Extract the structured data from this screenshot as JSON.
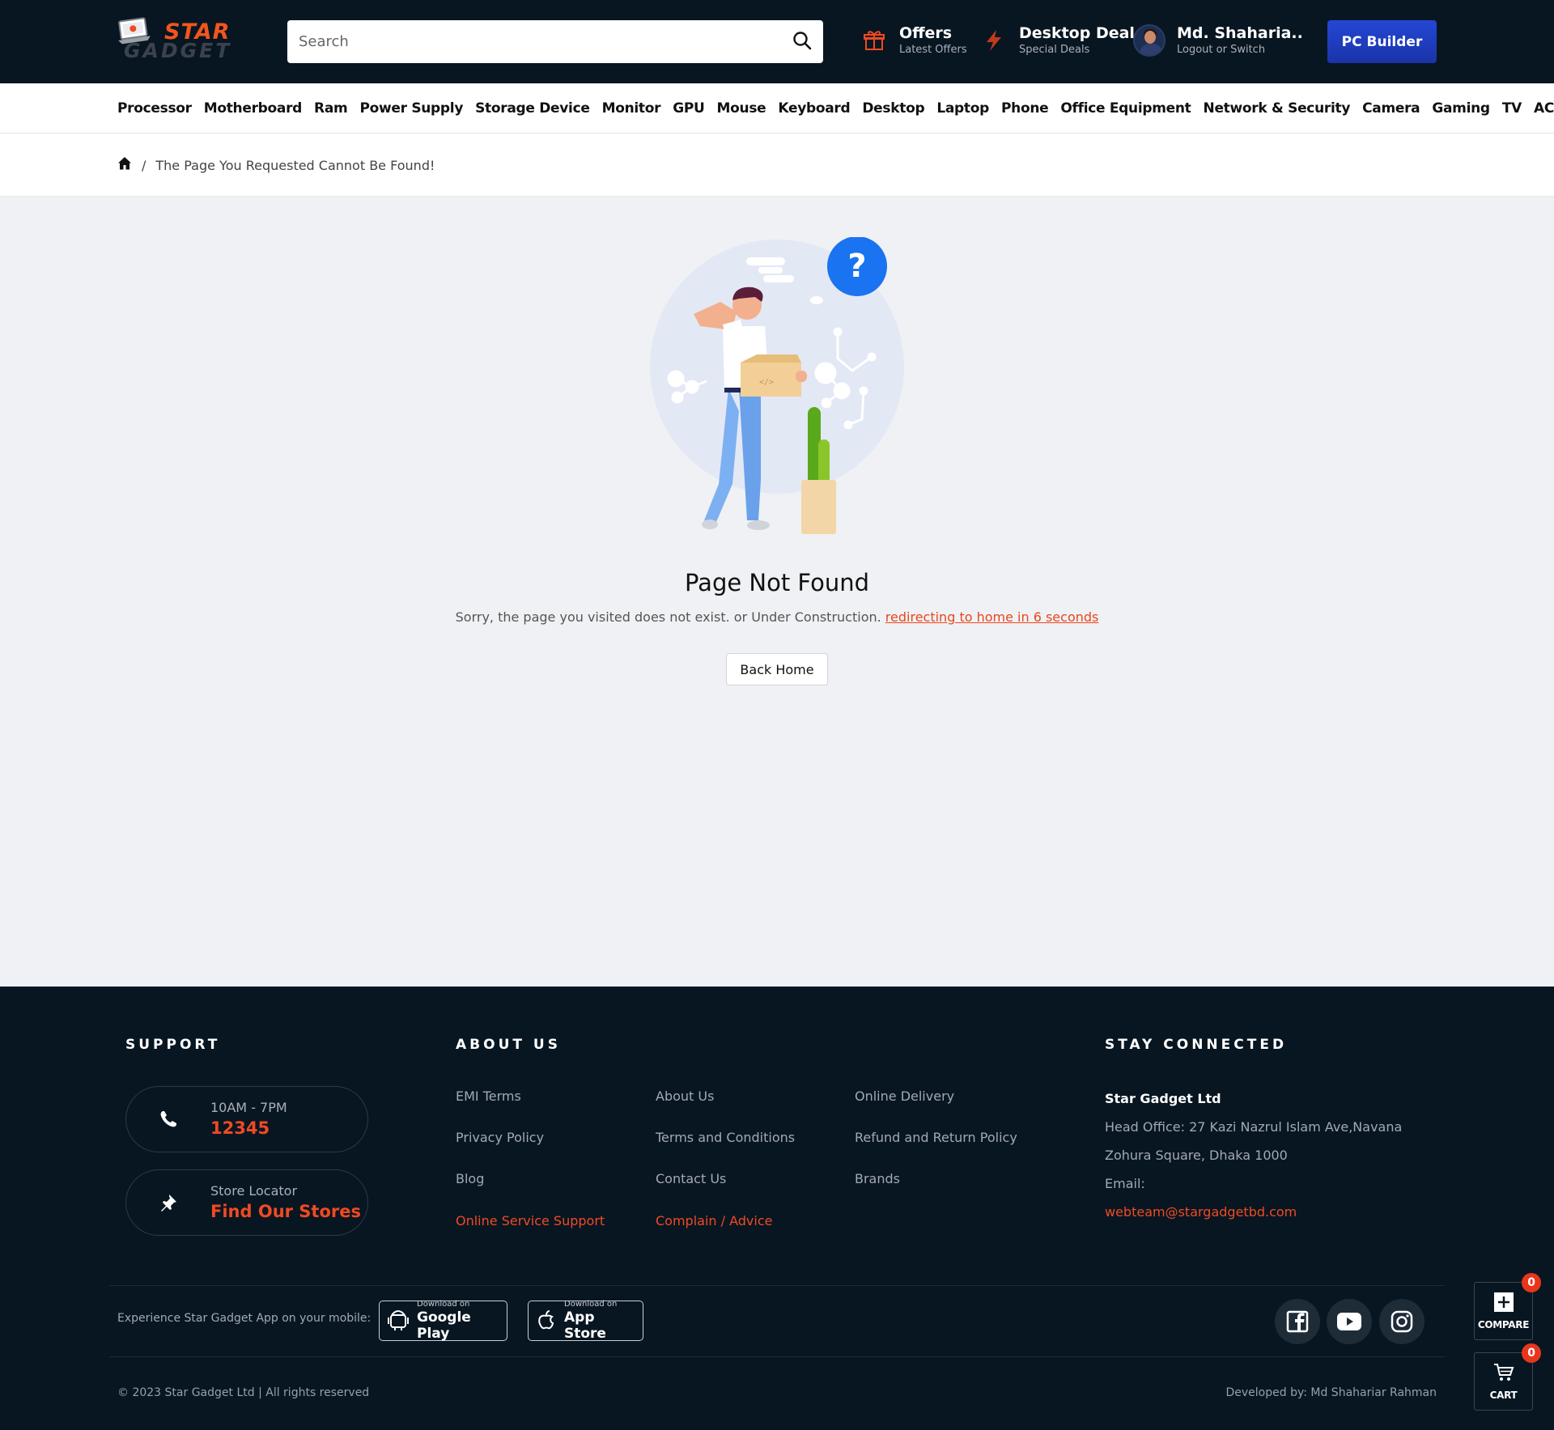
{
  "header": {
    "logo_top": "STAR",
    "logo_bottom": "GADGET",
    "search_placeholder": "Search",
    "offers_title": "Offers",
    "offers_sub": "Latest Offers",
    "deal_title": "Desktop Deal",
    "deal_sub": "Special Deals",
    "user_name": "Md. Shaharia..",
    "user_sub": "Logout or Switch",
    "pc_builder": "PC Builder"
  },
  "nav": {
    "items": [
      "Processor",
      "Motherboard",
      "Ram",
      "Power Supply",
      "Storage Device",
      "Monitor",
      "GPU",
      "Mouse",
      "Keyboard",
      "Desktop",
      "Laptop",
      "Phone",
      "Office Equipment",
      "Network & Security",
      "Camera",
      "Gaming",
      "TV",
      "AC"
    ]
  },
  "breadcrumb": {
    "separator": "/",
    "current": "The Page You Requested Cannot Be Found!"
  },
  "main": {
    "title": "Page Not Found",
    "message": "Sorry, the page you visited does not exist. or Under Construction.",
    "redirect": "redirecting to home in 6 seconds",
    "back_home": "Back Home",
    "question_mark": "?"
  },
  "footer": {
    "support_heading": "SUPPORT",
    "hours": "10AM - 7PM",
    "phone": "12345",
    "store_label": "Store Locator",
    "store_link": "Find Our Stores",
    "about_heading": "ABOUT US",
    "links": [
      "EMI Terms",
      "About Us",
      "Online Delivery",
      "Privacy Policy",
      "Terms and Conditions",
      "Refund and Return Policy",
      "Blog",
      "Contact Us",
      "Brands",
      "Online Service Support",
      "Complain / Advice"
    ],
    "connected_heading": "STAY CONNECTED",
    "company": "Star Gadget Ltd",
    "address1": "Head Office: 27 Kazi Nazrul Islam Ave,Navana",
    "address2": "Zohura Square, Dhaka 1000",
    "email_label": "Email:",
    "email": "webteam@stargadgetbd.com",
    "app_text": "Experience Star Gadget App on your mobile:",
    "gplay_small": "Download on",
    "gplay_big": "Google Play",
    "appstore_small": "Download on",
    "appstore_big": "App Store",
    "copyright": "© 2023 Star Gadget Ltd | All rights reserved",
    "developer": "Developed by: Md Shahariar Rahman"
  },
  "floating": {
    "compare_label": "COMPARE",
    "compare_count": "0",
    "cart_label": "CART",
    "cart_count": "0"
  },
  "colors": {
    "header_bg": "#081621",
    "accent": "#ef4a23",
    "builder_blue": "#1f3fbf"
  }
}
